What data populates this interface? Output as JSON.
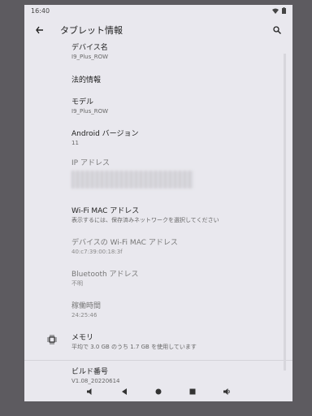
{
  "status": {
    "time": "16:40"
  },
  "appbar": {
    "title": "タブレット情報"
  },
  "items": [
    {
      "label": "デバイス名",
      "value": "I9_Plus_ROW"
    },
    {
      "label": "法的情報",
      "value": ""
    },
    {
      "label": "モデル",
      "value": "I9_Plus_ROW"
    },
    {
      "label": "Android バージョン",
      "value": "11"
    },
    {
      "label": "IP アドレス",
      "value": ""
    },
    {
      "label": "Wi-Fi MAC アドレス",
      "value": "表示するには、保存済みネットワークを選択してください"
    },
    {
      "label": "デバイスの Wi-Fi MAC アドレス",
      "value": "40:c7:39:00:18:3f"
    },
    {
      "label": "Bluetooth アドレス",
      "value": "不明"
    },
    {
      "label": "稼働時間",
      "value": "24:25:46"
    },
    {
      "label": "メモリ",
      "value": "平均で 3.0 GB のうち 1.7 GB を使用しています"
    },
    {
      "label": "ビルド番号",
      "value": "V1.08_20220614"
    }
  ],
  "icons": {
    "back": "back-arrow-icon",
    "search": "search-icon",
    "memory": "memory-chip-icon",
    "volume_down": "volume-down-icon",
    "back_nav": "nav-back-icon",
    "home": "nav-home-icon",
    "recents": "nav-recents-icon",
    "volume_up": "volume-up-icon"
  }
}
